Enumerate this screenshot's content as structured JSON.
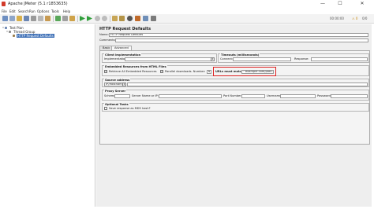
{
  "window": {
    "title": "Apache JMeter (5.1 r1853635)",
    "minimize": "—",
    "maximize": "☐",
    "close": "✕"
  },
  "menu": [
    "File",
    "Edit",
    "Search",
    "Run",
    "Options",
    "Tools",
    "Help"
  ],
  "toolbar": {
    "timer": "00:00:00",
    "warnings": "⚠ 0",
    "threads": "0/0"
  },
  "tree": {
    "items": [
      {
        "label": "Test Plan",
        "level": 0,
        "expanded": true,
        "selected": false
      },
      {
        "label": "Thread Group",
        "level": 1,
        "expanded": true,
        "selected": false
      },
      {
        "label": "HTTP Request Defaults",
        "level": 2,
        "expanded": false,
        "selected": true
      }
    ]
  },
  "main": {
    "heading": "HTTP Request Defaults",
    "name_label": "Name:",
    "name_value": "HTTP Request Defaults",
    "comments_label": "Comments:",
    "tabs": [
      {
        "label": "Basic",
        "active": false
      },
      {
        "label": "Advanced",
        "active": true
      }
    ],
    "client": {
      "title": "Client implementation",
      "impl_label": "Implementation:",
      "impl_value": ""
    },
    "timeouts": {
      "title": "Timeouts (milliseconds)",
      "connect_label": "Connect:",
      "response_label": "Response:"
    },
    "embedded": {
      "title": "Embedded Resources from HTML Files",
      "retrieve_label": "Retrieve All Embedded Resources",
      "retrieve_checked": true,
      "parallel_label": "Parallel downloads. Number:",
      "parallel_checked": true,
      "parallel_value": "6",
      "urls_label": "URLs must match:",
      "urls_value": "^example.com/path.*|"
    },
    "source": {
      "title": "Source address",
      "type_value": "IP/Hostname"
    },
    "proxy": {
      "title": "Proxy Server",
      "scheme_label": "Scheme:",
      "server_label": "Server Name or IP:",
      "port_label": "Port Number:",
      "user_label": "Username",
      "pass_label": "Password"
    },
    "optional": {
      "title": "Optional Tasks",
      "md5_label": "Save response as MD5 hash?"
    }
  },
  "colors": {
    "selection": "#3d6fb6",
    "highlight": "#dd2222",
    "run_green": "#2f9e3a",
    "stop_red": "#c83a2a"
  }
}
